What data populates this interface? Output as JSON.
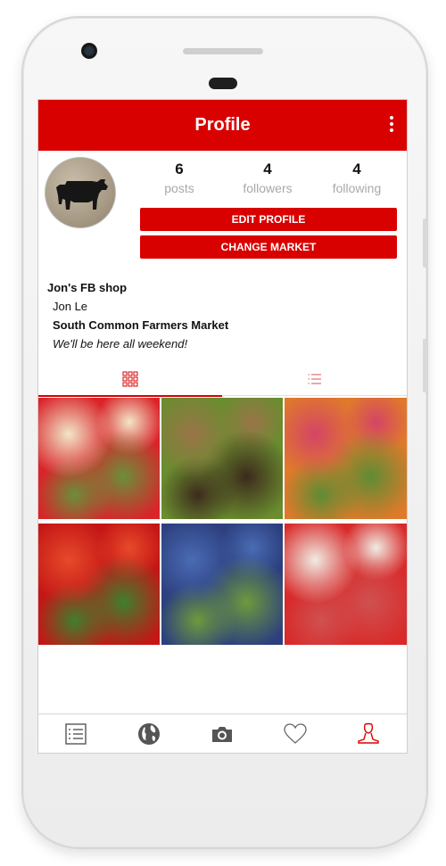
{
  "appbar": {
    "title": "Profile",
    "more_icon": "more-vert-icon"
  },
  "profile": {
    "avatar_icon": "cow-avatar",
    "stats": [
      {
        "value": "6",
        "label": "posts"
      },
      {
        "value": "4",
        "label": "followers"
      },
      {
        "value": "4",
        "label": "following"
      }
    ],
    "edit_label": "EDIT PROFILE",
    "change_label": "CHANGE MARKET",
    "shop_name": "Jon's FB shop",
    "owner_name": "Jon Le",
    "market_name": "South Common Farmers Market",
    "tagline": "We'll be here all weekend!"
  },
  "tabs": [
    {
      "icon": "grid-icon",
      "active": true
    },
    {
      "icon": "list-icon",
      "active": false
    }
  ],
  "photos": [
    {
      "name": "tacos-photo",
      "colors": [
        "#d9242a",
        "#f2e6c8",
        "#6b8f3a"
      ]
    },
    {
      "name": "greens-basket-photo",
      "colors": [
        "#6a8d2f",
        "#9a7448",
        "#3d2a1c"
      ]
    },
    {
      "name": "radish-carrot-photo",
      "colors": [
        "#e07a2a",
        "#d44466",
        "#5d8c34"
      ]
    },
    {
      "name": "peppers-photo",
      "colors": [
        "#c41616",
        "#e74a2a",
        "#3f7f2d"
      ]
    },
    {
      "name": "blueberries-photo",
      "colors": [
        "#2c3f7e",
        "#4a6bb3",
        "#6e9a3c"
      ]
    },
    {
      "name": "strawberries-photo",
      "colors": [
        "#d82a2a",
        "#f0ece4",
        "#d05151"
      ]
    }
  ],
  "bottom_nav": [
    {
      "icon": "list-icon",
      "active": false
    },
    {
      "icon": "globe-icon",
      "active": false
    },
    {
      "icon": "camera-icon",
      "active": false
    },
    {
      "icon": "heart-icon",
      "active": false
    },
    {
      "icon": "profile-icon",
      "active": true
    }
  ],
  "colors": {
    "accent": "#d90000",
    "muted": "#a8a8a8"
  }
}
